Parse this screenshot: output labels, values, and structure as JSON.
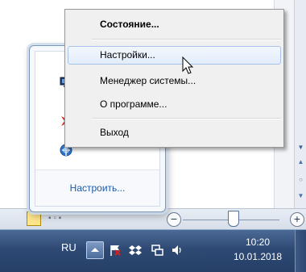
{
  "context_menu": {
    "items": [
      {
        "label": "Состояние...",
        "bold": true
      },
      {
        "label": "Настройки...",
        "hover": true
      },
      {
        "label": "Менеджер системы..."
      },
      {
        "label": "О программе..."
      },
      {
        "label": "Выход"
      }
    ]
  },
  "tray_panel": {
    "customize_label": "Настроить...",
    "icons": [
      "monitor-icon",
      "red-arrow-icon",
      "globe-icon"
    ]
  },
  "taskbar": {
    "language": "RU",
    "clock": {
      "time": "10:20",
      "date": "10.01.2018"
    }
  },
  "colors": {
    "taskbar": "#2e4a74",
    "menu_bg": "#f0f0f0",
    "menu_hover_border": "#a9c4ea",
    "link": "#1e5aa8"
  }
}
